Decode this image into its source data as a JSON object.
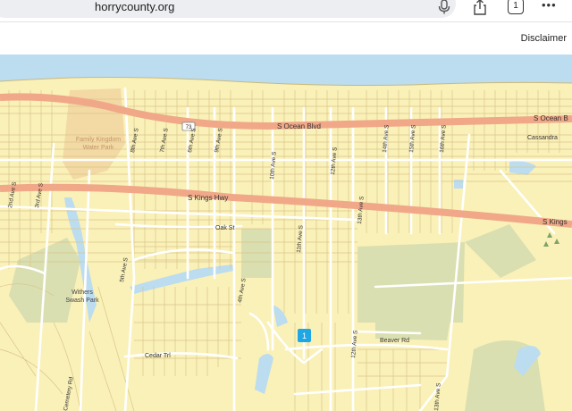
{
  "browser": {
    "url": "horrycounty.org",
    "tab_count": "1",
    "icons": [
      "microphone-icon",
      "share-icon",
      "tabs-icon",
      "more-icon"
    ]
  },
  "page": {
    "disclaimer_label": "Disclaimer"
  },
  "map": {
    "colors": {
      "water": "#bcdcf0",
      "land": "#faf1b8",
      "highway": "#f0a888",
      "park": "#d9dfb0",
      "marker": "#1ea7e4"
    },
    "route_shield": "73",
    "labels": {
      "s_ocean_blvd": "S Ocean Blvd",
      "s_ocean_b": "S Ocean B",
      "s_kings_hwy": "S Kings Hwy",
      "s_kings": "S Kings",
      "oak_st": "Oak St",
      "cedar_trl": "Cedar Trl",
      "beaver_rd": "Beaver Rd",
      "cassandra": "Cassandra",
      "family_kingdom_1": "Family Kingdom",
      "family_kingdom_2": "Water Park",
      "withers_1": "Withers",
      "withers_2": "Swash Park",
      "ave_8th": "8th Ave S",
      "ave_7th": "7th Ave S",
      "ave_6th": "6th Ave S",
      "ave_5th": "5th Ave S",
      "ave_10th": "10th Ave S",
      "ave_11th": "11th Ave S",
      "ave_12th": "12th Ave S",
      "ave_13th": "13th Ave S",
      "ave_14th": "14th Ave S",
      "ave_15th": "15th Ave S",
      "ave_16th": "16th Ave S",
      "ave_3rd": "3rd Ave S",
      "ave_2nd": "2nd Ave S",
      "ave_5th_b": "5th Ave S",
      "ave_9th": "9th Ave S",
      "ave_4th": "4th Ave S",
      "cemetery": "Cemetery Rd",
      "ave_12th_b": "12th Ave S"
    },
    "marker_label": "1"
  }
}
